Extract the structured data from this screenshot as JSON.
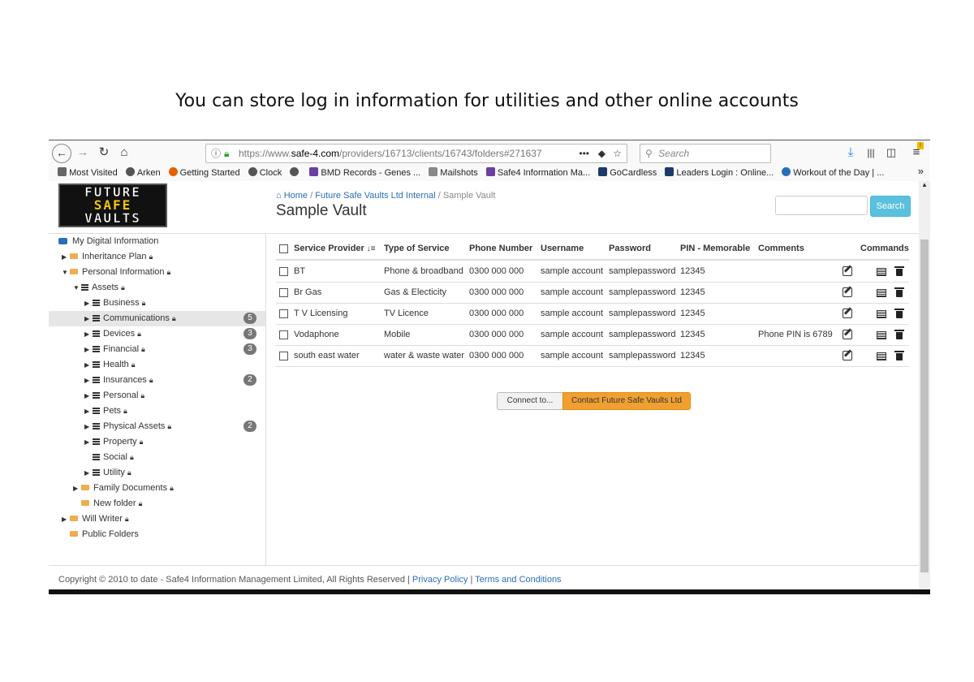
{
  "caption": "You can store log in information for utilities and other online accounts",
  "browser": {
    "url_prefix": "https://www.",
    "url_domain": "safe-4.com",
    "url_path": "/providers/16713/clients/16743/folders#271637",
    "search_placeholder": "Search",
    "bookmarks": [
      {
        "label": "Most Visited",
        "color": "#666"
      },
      {
        "label": "Arken",
        "color": "#555"
      },
      {
        "label": "Getting Started",
        "color": "#e66000"
      },
      {
        "label": "Clock",
        "color": "#555"
      },
      {
        "label": "",
        "color": "#555"
      },
      {
        "label": "BMD Records - Genes ...",
        "color": "#6a3fa0"
      },
      {
        "label": "Mailshots",
        "color": "#888"
      },
      {
        "label": "Safe4 Information Ma...",
        "color": "#6a3fa0"
      },
      {
        "label": "GoCardless",
        "color": "#1a3a6a"
      },
      {
        "label": "Leaders Login : Online...",
        "color": "#1a3a6a"
      },
      {
        "label": "Workout of the Day | ...",
        "color": "#2a6ebb"
      }
    ]
  },
  "logo": {
    "line1": "FUTURE",
    "line2": "SAFE",
    "line3": "VAULTS"
  },
  "breadcrumb": {
    "home": "Home",
    "parent": "Future Safe Vaults Ltd Internal",
    "current": "Sample Vault",
    "sep": "/"
  },
  "page_title": "Sample Vault",
  "search_button": "Search",
  "sidebar": {
    "items": [
      {
        "label": "My Digital Information",
        "type": "db",
        "caret": "",
        "lock": false,
        "badge": ""
      },
      {
        "label": "Inheritance Plan",
        "type": "folder",
        "caret": "▶",
        "lock": true,
        "badge": ""
      },
      {
        "label": "Personal Information",
        "type": "folder",
        "caret": "▼",
        "lock": true,
        "badge": ""
      },
      {
        "label": "Assets",
        "type": "list",
        "caret": "▼",
        "lock": true,
        "badge": ""
      },
      {
        "label": "Business",
        "type": "list",
        "caret": "▶",
        "lock": true,
        "badge": ""
      },
      {
        "label": "Communications",
        "type": "list",
        "caret": "▶",
        "lock": true,
        "badge": "5"
      },
      {
        "label": "Devices",
        "type": "list",
        "caret": "▶",
        "lock": true,
        "badge": "3"
      },
      {
        "label": "Financial",
        "type": "list",
        "caret": "▶",
        "lock": true,
        "badge": "3"
      },
      {
        "label": "Health",
        "type": "list",
        "caret": "▶",
        "lock": true,
        "badge": ""
      },
      {
        "label": "Insurances",
        "type": "list",
        "caret": "▶",
        "lock": true,
        "badge": "2"
      },
      {
        "label": "Personal",
        "type": "list",
        "caret": "▶",
        "lock": true,
        "badge": ""
      },
      {
        "label": "Pets",
        "type": "list",
        "caret": "▶",
        "lock": true,
        "badge": ""
      },
      {
        "label": "Physical Assets",
        "type": "list",
        "caret": "▶",
        "lock": true,
        "badge": "2"
      },
      {
        "label": "Property",
        "type": "list",
        "caret": "▶",
        "lock": true,
        "badge": ""
      },
      {
        "label": "Social",
        "type": "list",
        "caret": "",
        "lock": true,
        "badge": ""
      },
      {
        "label": "Utility",
        "type": "list",
        "caret": "▶",
        "lock": true,
        "badge": ""
      },
      {
        "label": "Family Documents",
        "type": "folder",
        "caret": "▶",
        "lock": true,
        "badge": ""
      },
      {
        "label": "New folder",
        "type": "folder",
        "caret": "",
        "lock": true,
        "badge": ""
      },
      {
        "label": "Will Writer",
        "type": "folder",
        "caret": "▶",
        "lock": true,
        "badge": ""
      },
      {
        "label": "Public Folders",
        "type": "folder",
        "caret": "",
        "lock": false,
        "badge": ""
      }
    ]
  },
  "table": {
    "headers": [
      "Service Provider",
      "Type of Service",
      "Phone Number",
      "Username",
      "Password",
      "PIN - Memorable",
      "Comments",
      "Commands"
    ],
    "rows": [
      [
        "BT",
        "Phone & broadband",
        "0300 000 000",
        "sample account",
        "samplepassword",
        "12345",
        ""
      ],
      [
        "Br Gas",
        "Gas & Electicity",
        "0300 000 000",
        "sample account",
        "samplepassword",
        "12345",
        ""
      ],
      [
        "T V Licensing",
        "TV Licence",
        "0300 000 000",
        "sample account",
        "samplepassword",
        "12345",
        ""
      ],
      [
        "Vodaphone",
        "Mobile",
        "0300 000 000",
        "sample account",
        "samplepassword",
        "12345",
        "Phone PIN is 6789"
      ],
      [
        "south east water",
        "water & waste water",
        "0300 000 000",
        "sample account",
        "samplepassword",
        "12345",
        ""
      ]
    ]
  },
  "buttons": {
    "connect": "Connect to...",
    "contact": "Contact Future Safe Vaults Ltd"
  },
  "footer": {
    "copyright": "Copyright © 2010 to date - Safe4 Information Management Limited, All Rights Reserved |",
    "privacy": "Privacy Policy",
    "sep": "|",
    "terms": "Terms and Conditions"
  }
}
